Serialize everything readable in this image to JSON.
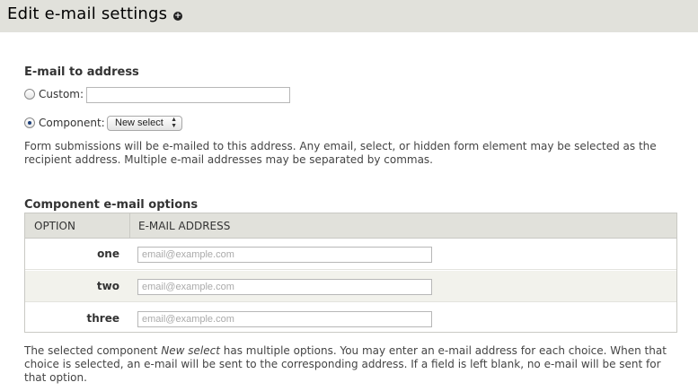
{
  "header": {
    "title": "Edit e-mail settings",
    "icon": "add-circle-icon"
  },
  "email_to": {
    "section_label": "E-mail to address",
    "custom_label": "Custom:",
    "custom_value": "",
    "custom_selected": false,
    "component_label": "Component:",
    "component_selected": true,
    "component_select_value": "New select",
    "description": "Form submissions will be e-mailed to this address. Any email, select, or hidden form element may be selected as the recipient address. Multiple e-mail addresses may be separated by commas."
  },
  "component_options": {
    "section_label": "Component e-mail options",
    "columns": [
      "Option",
      "E-mail address"
    ],
    "rows": [
      {
        "option": "one",
        "placeholder": "email@example.com",
        "value": ""
      },
      {
        "option": "two",
        "placeholder": "email@example.com",
        "value": ""
      },
      {
        "option": "three",
        "placeholder": "email@example.com",
        "value": ""
      }
    ],
    "footer_prefix": "The selected component ",
    "footer_component": "New select",
    "footer_suffix": " has multiple options. You may enter an e-mail address for each choice. When that choice is selected, an e-mail will be sent to the corresponding address. If a field is left blank, no e-mail will be sent for that option."
  }
}
